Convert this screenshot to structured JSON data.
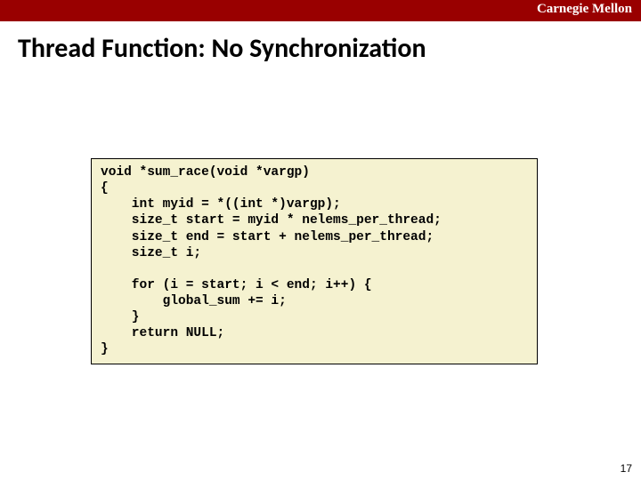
{
  "header": {
    "org": "Carnegie Mellon"
  },
  "slide": {
    "title": "Thread Function: No Synchronization",
    "page_number": "17"
  },
  "code": {
    "text": "void *sum_race(void *vargp)\n{\n    int myid = *((int *)vargp);\n    size_t start = myid * nelems_per_thread;\n    size_t end = start + nelems_per_thread;\n    size_t i;\n\n    for (i = start; i < end; i++) {\n        global_sum += i;\n    }\n    return NULL;\n}"
  }
}
